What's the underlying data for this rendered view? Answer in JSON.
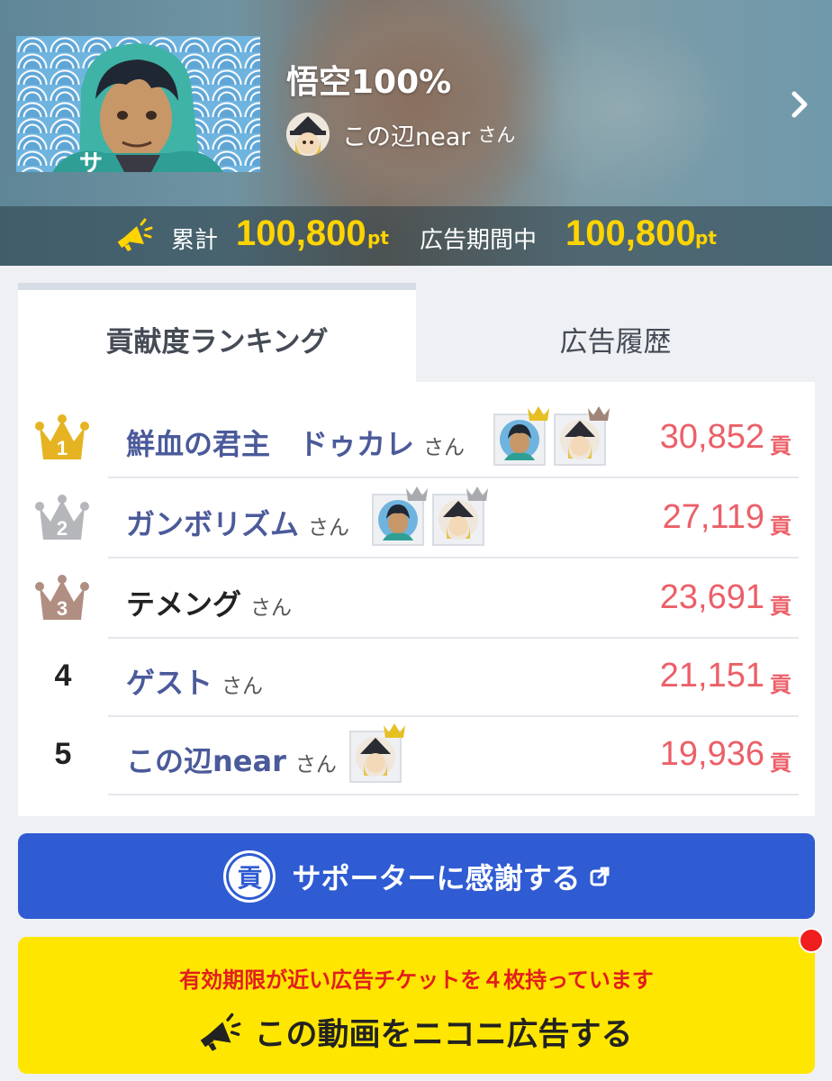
{
  "video": {
    "title": "悟空100%",
    "owner_name": "この辺near",
    "owner_suffix": "さん"
  },
  "stats": {
    "total_label": "累計",
    "total_value": "100,800",
    "total_unit": "pt",
    "period_label": "広告期間中",
    "period_value": "100,800",
    "period_unit": "pt"
  },
  "tabs": [
    {
      "label": "貢献度ランキング",
      "active": true
    },
    {
      "label": "広告履歴",
      "active": false
    }
  ],
  "ranking": [
    {
      "rank": "1",
      "name": "鮮血の君主　ドゥカレ",
      "suffix": "さん",
      "score": "30,852",
      "unit": "貢"
    },
    {
      "rank": "2",
      "name": "ガンボリズム",
      "suffix": "さん",
      "score": "27,119",
      "unit": "貢"
    },
    {
      "rank": "3",
      "name": "テメング",
      "suffix": "さん",
      "score": "23,691",
      "unit": "貢"
    },
    {
      "rank": "4",
      "name": "ゲスト",
      "suffix": "さん",
      "score": "21,151",
      "unit": "貢"
    },
    {
      "rank": "5",
      "name": "この辺near",
      "suffix": "さん",
      "score": "19,936",
      "unit": "貢"
    }
  ],
  "thank_button": {
    "icon_text": "貢",
    "label": "サポーターに感謝する"
  },
  "ad_button": {
    "notice": "有効期限が近い広告チケットを４枚持っています",
    "label": "この動画をニコニ広告する"
  },
  "colors": {
    "accent_blue": "#2f5bd3",
    "ad_yellow": "#ffe600",
    "score_red": "#ec5f68",
    "name_blue": "#4b5a9a",
    "stat_yellow": "#ffd400"
  },
  "icons": [
    "chevron-right-icon",
    "megaphone-icon",
    "gold-crown-icon",
    "silver-crown-icon",
    "bronze-crown-icon",
    "external-link-icon",
    "notification-dot"
  ]
}
